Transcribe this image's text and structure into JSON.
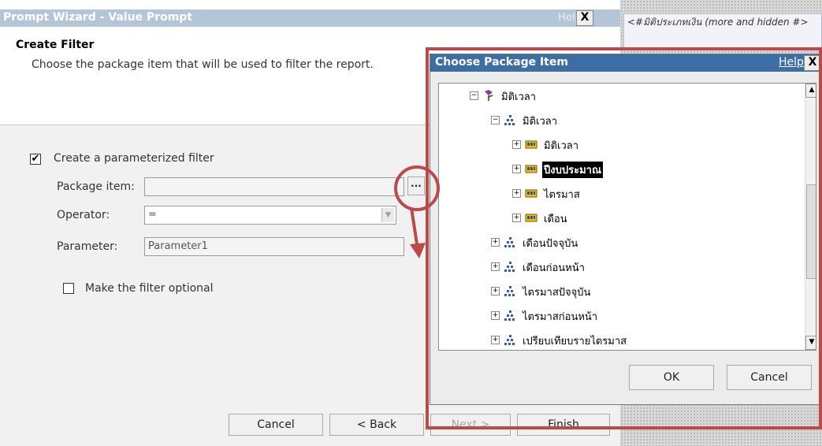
{
  "wizard": {
    "title": "Prompt Wizard - Value Prompt",
    "help": "Help",
    "close": "X",
    "heading": "Create Filter",
    "description": "Choose the package item that will be used to filter the report.",
    "parameterized_checked": true,
    "parameterized_label": "Create a parameterized filter",
    "package_item_label": "Package item:",
    "package_item_value": "",
    "browse_label": "...",
    "operator_label": "Operator:",
    "operator_value": "=",
    "parameter_label": "Parameter:",
    "parameter_value": "Parameter1",
    "optional_checked": false,
    "optional_label": "Make the filter optional",
    "buttons": {
      "cancel": "Cancel",
      "back": "< Back",
      "next": "Next >",
      "finish": "Finish"
    }
  },
  "background_panel": {
    "note": "<#มิติประเภทเงิน (more and hidden #>"
  },
  "dialog": {
    "title": "Choose Package Item",
    "help": "Help",
    "close": "X",
    "tree": [
      {
        "label": "มิติเวลา",
        "icon": "namespace-icon",
        "level": 0,
        "expander": "⊟",
        "selected": false
      },
      {
        "label": "มิติเวลา",
        "icon": "dimension-icon",
        "level": 1,
        "expander": "⊟",
        "selected": false
      },
      {
        "label": "มิติเวลา",
        "icon": "level-icon",
        "level": 2,
        "expander": "⊞",
        "selected": false
      },
      {
        "label": "ปีงบประมาณ",
        "icon": "level-icon",
        "level": 2,
        "expander": "⊞",
        "selected": true
      },
      {
        "label": "ไตรมาส",
        "icon": "level-icon",
        "level": 2,
        "expander": "⊞",
        "selected": false
      },
      {
        "label": "เดือน",
        "icon": "level-icon",
        "level": 2,
        "expander": "⊞",
        "selected": false
      },
      {
        "label": "เดือนปัจจุบัน",
        "icon": "dimension-icon",
        "level": 1,
        "expander": "⊞",
        "selected": false
      },
      {
        "label": "เดือนก่อนหน้า",
        "icon": "dimension-icon",
        "level": 1,
        "expander": "⊞",
        "selected": false
      },
      {
        "label": "ไตรมาสปัจจุบัน",
        "icon": "dimension-icon",
        "level": 1,
        "expander": "⊞",
        "selected": false
      },
      {
        "label": "ไตรมาสก่อนหน้า",
        "icon": "dimension-icon",
        "level": 1,
        "expander": "⊞",
        "selected": false
      },
      {
        "label": "เปรียบเทียบรายไตรมาส",
        "icon": "dimension-icon",
        "level": 1,
        "expander": "⊞",
        "selected": false
      }
    ],
    "ok": "OK",
    "cancel": "Cancel"
  },
  "colors": {
    "wizard_title_bar": "#b5c5d8",
    "dialog_title_bar": "#3b6ea5",
    "annotation_red": "#b94b4b"
  }
}
